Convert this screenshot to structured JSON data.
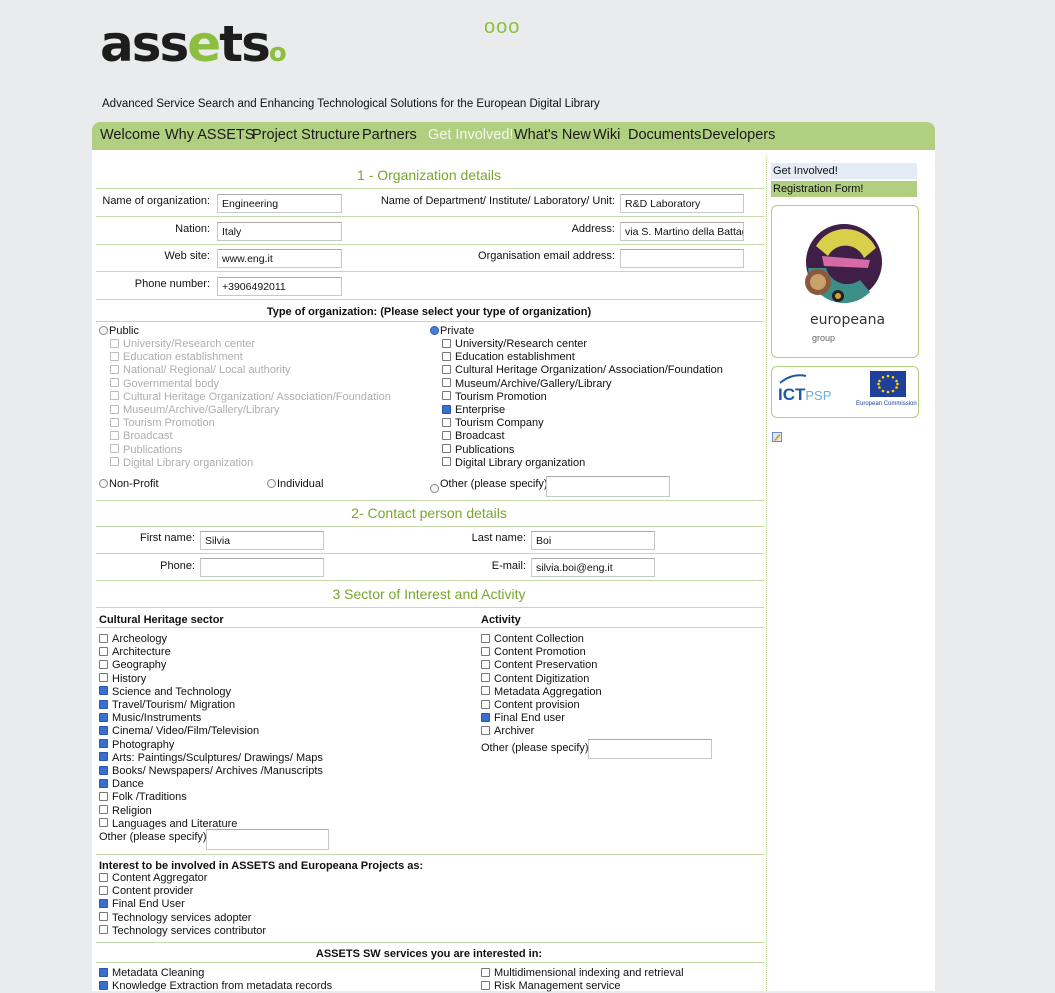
{
  "header": {
    "logo_text_start": "ass",
    "logo_text_mid": "e",
    "logo_text_end": "ts",
    "dots": "ooo",
    "tagline": "Advanced Service Search and Enhancing Technological Solutions for the European Digital Library"
  },
  "nav": [
    {
      "label": "Welcome",
      "active": false
    },
    {
      "label": "Why ASSETS",
      "active": false
    },
    {
      "label": "Project Structure",
      "active": false
    },
    {
      "label": "Partners",
      "active": false
    },
    {
      "label": "Get Involved!",
      "active": true
    },
    {
      "label": "What's New",
      "active": false
    },
    {
      "label": "Wiki",
      "active": false
    },
    {
      "label": "Documents",
      "active": false
    },
    {
      "label": "Developers",
      "active": false
    }
  ],
  "org": {
    "title": "1 - Organization details",
    "name_label": "Name of organization:",
    "name_value": "Engineering",
    "dept_label": "Name of Department/ Institute/ Laboratory/ Unit:",
    "dept_value": "R&D Laboratory",
    "nation_label": "Nation:",
    "nation_value": "Italy",
    "address_label": "Address:",
    "address_value": "via S. Martino della Battag",
    "web_label": "Web site:",
    "web_value": "www.eng.it",
    "email_label": "Organisation email address:",
    "email_value": "",
    "phone_label": "Phone number:",
    "phone_value": "+3906492011"
  },
  "type": {
    "heading": "Type of organization: (Please select your type of organization)",
    "public_label": "Public",
    "public_items": [
      "University/Research center",
      "Education establishment",
      "National/ Regional/ Local authority",
      "Governmental body",
      "Cultural Heritage Organization/ Association/Foundation",
      "Museum/Archive/Gallery/Library",
      "Tourism Promotion",
      "Broadcast",
      "Publications",
      "Digital Library organization"
    ],
    "private_label": "Private",
    "private_items": [
      "University/Research center",
      "Education establishment",
      "Cultural Heritage Organization/ Association/Foundation",
      "Museum/Archive/Gallery/Library",
      "Tourism Promotion",
      "Enterprise",
      "Tourism Company",
      "Broadcast",
      "Publications",
      "Digital Library organization"
    ],
    "private_checked": [
      false,
      false,
      false,
      false,
      false,
      true,
      false,
      false,
      false,
      false
    ],
    "nonprofit_label": "Non-Profit",
    "individual_label": "Individual",
    "other_label": "Other (please specify):"
  },
  "contact": {
    "title": "2- Contact person details",
    "first_label": "First name:",
    "first_value": "Silvia",
    "last_label": "Last name:",
    "last_value": "Boi",
    "phone_label": "Phone:",
    "phone_value": "",
    "email_label": "E-mail:",
    "email_value": "silvia.boi@eng.it"
  },
  "sector": {
    "title": "3  Sector of Interest and Activity",
    "cultural_heading": "Cultural Heritage sector",
    "cultural_items": [
      "Archeology",
      "Architecture",
      "Geography",
      "History",
      "Science and Technology",
      "Travel/Tourism/ Migration",
      "Music/Instruments",
      "Cinema/ Video/Film/Television",
      "Photography",
      "Arts: Paintings/Sculptures/ Drawings/ Maps",
      "Books/ Newspapers/ Archives /Manuscripts",
      "Dance",
      "Folk /Traditions",
      "Religion",
      "Languages and Literature"
    ],
    "cultural_checked": [
      false,
      false,
      false,
      false,
      true,
      true,
      true,
      true,
      true,
      true,
      true,
      true,
      false,
      false,
      false
    ],
    "cultural_other_label": "Other (please specify):",
    "activity_heading": "Activity",
    "activity_items": [
      "Content Collection",
      "Content Promotion",
      "Content Preservation",
      "Content Digitization",
      "Metadata Aggregation",
      "Content provision",
      "Final End user",
      "Archiver"
    ],
    "activity_checked": [
      false,
      false,
      false,
      false,
      false,
      false,
      true,
      false
    ],
    "activity_other_label": "Other (please specify):"
  },
  "interest": {
    "heading": "Interest to be involved in ASSETS and Europeana Projects as:",
    "items": [
      "Content Aggregator",
      "Content provider",
      "Final End User",
      "Technology services adopter",
      "Technology services contributor"
    ],
    "checked": [
      false,
      false,
      true,
      false,
      false
    ]
  },
  "services": {
    "heading": "ASSETS SW services you are interested in:",
    "left_items": [
      "Metadata Cleaning",
      "Knowledge Extraction from metadata records"
    ],
    "left_checked": [
      true,
      true
    ],
    "right_items": [
      "Multidimensional indexing and retrieval",
      "Risk Management service"
    ],
    "right_checked": [
      false,
      false
    ]
  },
  "sidebar": {
    "link1": "Get Involved!",
    "link2": "Registration Form!",
    "europeana_name": "europeana",
    "europeana_sub": "group",
    "ict_text": "ICT",
    "psp_text": "PSP",
    "ec_text": "European Commission"
  },
  "colors": {
    "accent": "#8cbf3f",
    "nav_bg": "#b0cf80",
    "section_title": "#79a630",
    "page_bg": "#e9ebed"
  }
}
